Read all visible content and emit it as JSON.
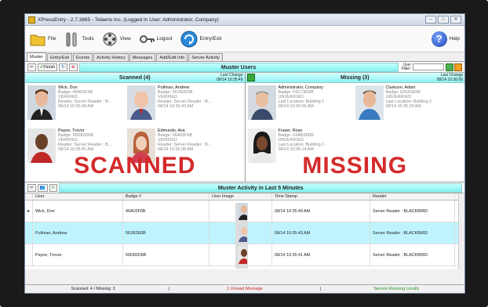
{
  "window": {
    "title": "XPressEntry - 2.7.3865 - Telaeris Inc. (Logged In User: Administrator, Company)"
  },
  "toolbar": {
    "file": "File",
    "tools": "Tools",
    "view": "View",
    "logout": "Logout",
    "entryexit": "Entry/Exit",
    "help": "Help"
  },
  "tabs": [
    "Muster",
    "Entry/Exit",
    "Events",
    "Activity History",
    "Messages",
    "Add/Edit Info",
    "Server Activity"
  ],
  "muster": {
    "finish": "Finish",
    "title": "Muster Users",
    "filter_label_1": "User",
    "filter_label_2": "Filter:"
  },
  "scanned": {
    "title": "Scanned (4)",
    "lastchange_label": "Last Change",
    "lastchange": "08/14 10:35:49",
    "big": "SCANNED",
    "people": [
      {
        "name": "Wick, Don",
        "badge": "Badge: 46A02F6B",
        "status": "VERIFIED",
        "reader": "Reader: Server Reader : B...",
        "time": "08/14 10:35:49 AM"
      },
      {
        "name": "Pullman, Andrew",
        "badge": "Badge: 561B2E6B",
        "status": "VERIFIED",
        "reader": "Reader: Server Reader : B...",
        "time": "08/14 10:35:43 AM"
      },
      {
        "name": "Payne, Trevor",
        "badge": "Badge: 56D82D6B",
        "status": "VERIFIED",
        "reader": "Reader: Server Reader : B...",
        "time": "08/14 10:35:41 AM"
      },
      {
        "name": "Edmunds, Ava",
        "badge": "Badge: 06A02F6B",
        "status": "VERIFIED",
        "reader": "Reader: Server Reader : B...",
        "time": "08/14 10:35:38 AM"
      }
    ]
  },
  "missing": {
    "title": "Missing (3)",
    "lastchange_label": "Last Change",
    "lastchange": "08/14 10:36:06",
    "big": "MISSING",
    "people": [
      {
        "name": "Administrator, Company",
        "badge": "Badge: F6C73D6B",
        "status": "UNVERIFIED",
        "loc": "Last Location: Building 1",
        "time": "08/14 10:36:06 AM"
      },
      {
        "name": "Clarkson, Adam",
        "badge": "Badge: E6542E6B",
        "status": "UNVERIFIED",
        "loc": "Last Location: Building 2",
        "time": "08/14 10:35:20 AM"
      },
      {
        "name": "Fraser, Rose",
        "badge": "Badge: F6AB2E6B",
        "status": "UNVERIFIED",
        "loc": "Last Location: Building 1",
        "time": "08/14 10:35:14 AM"
      }
    ]
  },
  "activity": {
    "title": "Muster Activity in Last 5 Minutes",
    "columns": [
      "User",
      "Badge #",
      "User Image",
      "Time Stamp",
      "Reader"
    ],
    "rows": [
      {
        "user": "Wick, Don",
        "badge": "46A02F6B",
        "time": "08/14 10:35:49 AM",
        "reader": "Server Reader : BLACKBIRD"
      },
      {
        "user": "Pullman, Andrew",
        "badge": "561B2E6B",
        "time": "08/14 10:35:43 AM",
        "reader": "Server Reader : BLACKBIRD"
      },
      {
        "user": "Payne, Trevor",
        "badge": "56D82D6B",
        "time": "08/14 10:35:41 AM",
        "reader": "Server Reader : BLACKBIRD"
      }
    ]
  },
  "status": {
    "counts": "Scanned: 4 / Missing: 3",
    "sep1": "|",
    "messages": "1 Unread Message",
    "sep2": "|",
    "service": "Service Running Locally"
  },
  "colors": {
    "accent_header": "#8ef2f2",
    "big_text": "#d42a2a",
    "row_selected": "#bff4ff"
  }
}
